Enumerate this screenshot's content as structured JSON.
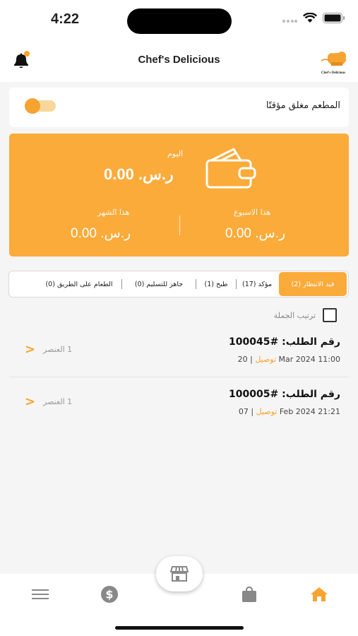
{
  "status_bar": {
    "time": "4:22"
  },
  "header": {
    "title": "Chef's Delicious",
    "logo_text": "Chef's Delicious"
  },
  "restaurant": {
    "closed_label": "المطعم مغلق مؤقتًا",
    "toggle_on": true
  },
  "earnings": {
    "today_label": "اليوم",
    "today_value": "ر.س. 0.00",
    "week_label": "هذا الاسبوع",
    "week_value": "ر.س. 0.00",
    "month_label": "هذا الشهر",
    "month_value": "ر.س. 0.00"
  },
  "tabs": [
    {
      "label": "قيد الانتظار (2)",
      "active": true
    },
    {
      "label": "مؤكد (17)",
      "active": false
    },
    {
      "label": "طبخ (1)",
      "active": false
    },
    {
      "label": "جاهز للتسليم (0)",
      "active": false
    },
    {
      "label": "الطعام على الطريق (0)",
      "active": false
    }
  ],
  "bulk": {
    "label": "ترتيب الجملة"
  },
  "orders": [
    {
      "number": "رقم الطلب: #100045",
      "datetime": "20 Mar 2024   11:00",
      "sep": "|",
      "type": "توصيل",
      "items": "1 العنصر"
    },
    {
      "number": "رقم الطلب: #100005",
      "datetime": "07 Feb 2024   21:21",
      "sep": "|",
      "type": "توصيل",
      "items": "1 العنصر"
    }
  ],
  "nav": {
    "menu_icon": "menu-icon",
    "money_icon": "dollar-icon",
    "store_icon": "store-icon",
    "bag_icon": "bag-icon",
    "home_icon": "home-icon"
  },
  "colors": {
    "accent": "#fbab3a",
    "orange_text": "#f6a330"
  }
}
